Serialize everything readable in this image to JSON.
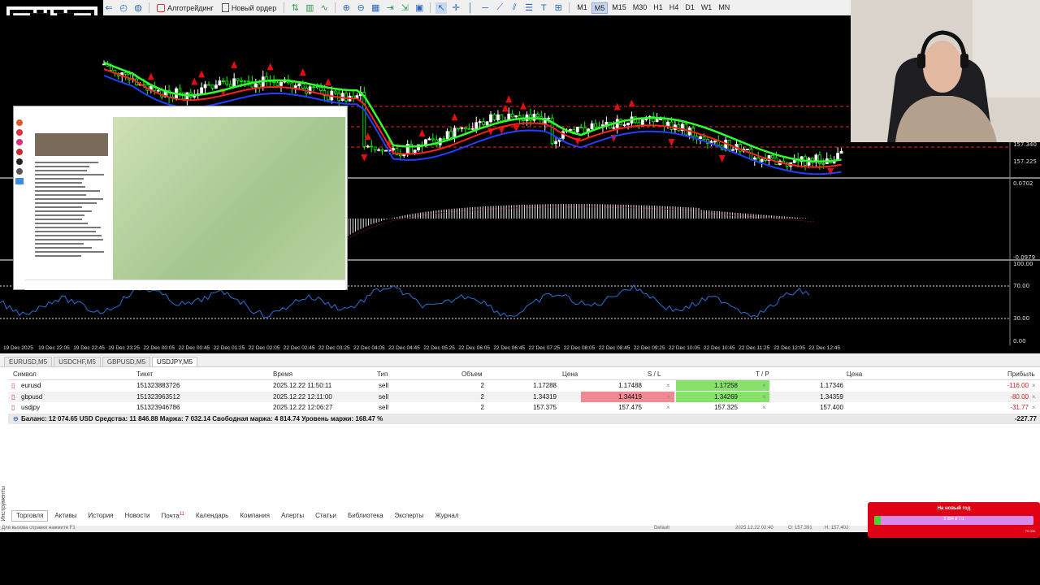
{
  "toolbar": {
    "algo_label": "Алготрейдинг",
    "new_order_label": "Новый ордер",
    "timeframes": [
      "M1",
      "M5",
      "M15",
      "M30",
      "H1",
      "H4",
      "D1",
      "W1",
      "MN"
    ],
    "active_timeframe": "M5"
  },
  "price_axis": {
    "mid_labels": [
      "157.340",
      "157.225"
    ],
    "macd_labels": [
      "0.0702",
      "-0.0979"
    ],
    "rsi_labels": [
      "100.00",
      "70.00",
      "30.00",
      "0.00"
    ]
  },
  "date_axis": [
    "19 Dec 2025",
    "19 Dec 22:05",
    "19 Dec 22:45",
    "19 Dec 23:25",
    "22 Dec 00:05",
    "22 Dec 00:45",
    "22 Dec 01:25",
    "22 Dec 02:05",
    "22 Dec 02:45",
    "22 Dec 03:25",
    "22 Dec 04:05",
    "22 Dec 04:45",
    "22 Dec 05:25",
    "22 Dec 06:05",
    "22 Dec 06:45",
    "22 Dec 07:25",
    "22 Dec 08:05",
    "22 Dec 08:45",
    "22 Dec 09:25",
    "22 Dec 10:05",
    "22 Dec 10:45",
    "22 Dec 11:25",
    "22 Dec 12:05",
    "22 Dec 12:45"
  ],
  "symbol_tabs": [
    "EURUSD,M5",
    "USDCHF,M5",
    "GBPUSD,M5",
    "USDJPY,M5"
  ],
  "active_symbol_tab": "USDJPY,M5",
  "trade_table": {
    "headers": {
      "symbol": "Символ",
      "ticket": "Тикет",
      "time": "Время",
      "type": "Тип",
      "volume": "Объем",
      "price": "Цена",
      "sl": "S / L",
      "tp": "T / P",
      "cur_price": "Цена",
      "profit": "Прибыль"
    },
    "rows": [
      {
        "symbol": "eurusd",
        "ticket": "151323883726",
        "time": "2025.12.22 11:50:11",
        "type": "sell",
        "volume": "2",
        "price": "1.17288",
        "sl": "1.17488",
        "tp": "1.17258",
        "cur_price": "1.17346",
        "profit": "-116.00",
        "sl_hl": false,
        "tp_hl": true
      },
      {
        "symbol": "gbpusd",
        "ticket": "151323963512",
        "time": "2025.12.22 12:11:00",
        "type": "sell",
        "volume": "2",
        "price": "1.34319",
        "sl": "1.34419",
        "tp": "1.34269",
        "cur_price": "1.34359",
        "profit": "-80.00",
        "sl_hl": true,
        "tp_hl": true
      },
      {
        "symbol": "usdjpy",
        "ticket": "151323946786",
        "time": "2025.12.22 12:06:27",
        "type": "sell",
        "volume": "2",
        "price": "157.375",
        "sl": "157.475",
        "tp": "157.325",
        "cur_price": "157.400",
        "profit": "-31.77",
        "sl_hl": false,
        "tp_hl": false
      }
    ],
    "balance_text": "Баланс: 12 074.65 USD  Средства: 11 846.88  Маржа: 7 032.14  Свободная маржа: 4 814.74  Уровень маржи: 168.47 %",
    "total_profit": "-227.77"
  },
  "bottom_tabs": [
    "Торговля",
    "Активы",
    "История",
    "Новости",
    "Почта",
    "Календарь",
    "Компания",
    "Алерты",
    "Статьи",
    "Библиотека",
    "Эксперты",
    "Журнал"
  ],
  "mail_badge": "11",
  "status_bar": {
    "help": "Для вызова справки нажмите F1",
    "profile": "Default",
    "datetime": "2025.12.22 02:40",
    "price1": "O: 157.391",
    "price2": "H: 157.402"
  },
  "side_label": "Инструменты",
  "promo": {
    "title": "На новый год",
    "amount": "3 384 ₽ 1:1",
    "goal": "75 000",
    "progress": 0.04,
    "color": "#e00015"
  },
  "colors": {
    "bull": "#ffffff",
    "bear": "#00ff00",
    "ma_red": "#ff2020",
    "ma_blue": "#2040ff",
    "ma_green": "#30ff30",
    "rsi": "#2f6fd6"
  }
}
